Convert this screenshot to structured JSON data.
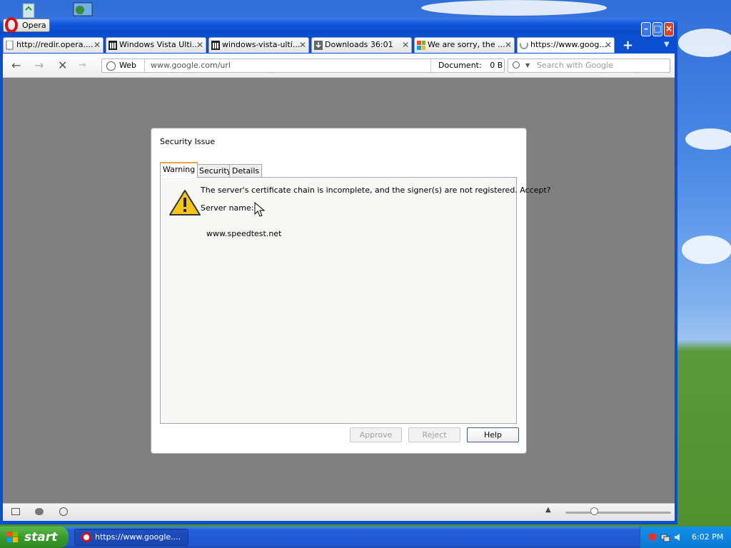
{
  "browser": {
    "menu_label": "Opera",
    "tabs": [
      {
        "label": "http://redir.opera....",
        "icon": "page-icon"
      },
      {
        "label": "Windows Vista Ulti...",
        "icon": "library-icon"
      },
      {
        "label": "windows-vista-ulti...",
        "icon": "library-icon"
      },
      {
        "label": "Downloads 36:01",
        "icon": "download-icon"
      },
      {
        "label": "We are sorry, the ...",
        "icon": "windows-logo-icon"
      },
      {
        "label": "https://www.goog...",
        "icon": "loading-icon"
      }
    ],
    "tab_close": "✕",
    "new_tab": "+",
    "address": {
      "mode": "Web",
      "url": "www.google.com/url",
      "document_label": "Document:",
      "document_size": "0 B"
    },
    "search": {
      "placeholder": "Search with Google"
    }
  },
  "dialog": {
    "title": "Security Issue",
    "tabs": [
      "Warning",
      "Security",
      "Details"
    ],
    "active_tab": "Warning",
    "message": "The server's certificate chain is incomplete, and the signer(s) are not registered. Accept?",
    "server_label": "Server name:",
    "server_name": "www.speedtest.net",
    "buttons": {
      "approve": "Approve",
      "reject": "Reject",
      "help": "Help"
    }
  },
  "taskbar": {
    "start_label": "start",
    "task_item": "https://www.google....",
    "clock": "6:02 PM"
  },
  "colors": {
    "titlebar": "#0a4fd0",
    "content_bg": "#808080",
    "warning_yellow": "#f5c518",
    "active_tab_accent": "#e8a33a"
  }
}
